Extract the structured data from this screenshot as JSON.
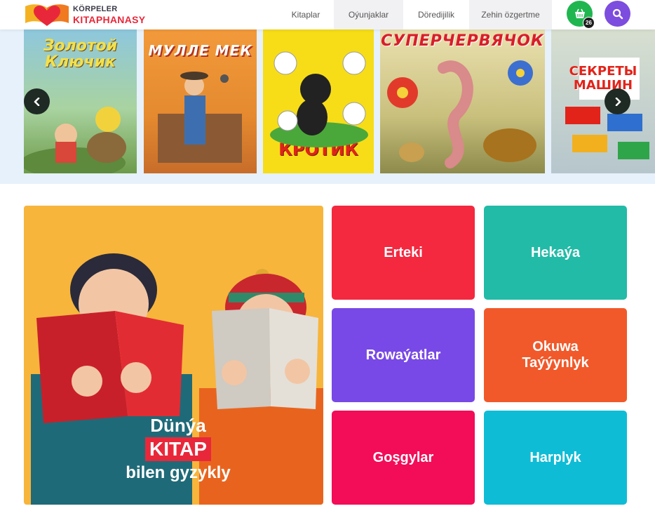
{
  "header": {
    "logo": {
      "line1": "KÖRPELER",
      "line2": "KITAPHANASY",
      "icon": "open-book-heart-icon"
    },
    "nav": [
      {
        "label": "Kitaplar"
      },
      {
        "label": "Oýunjaklar"
      },
      {
        "label": "Döredijilik"
      },
      {
        "label": "Zehin özgertme"
      }
    ],
    "cart": {
      "icon": "basket-icon",
      "count": "26",
      "color": "#1fb650"
    },
    "search": {
      "icon": "search-icon",
      "color": "#7c4ddf"
    }
  },
  "carousel": {
    "books": [
      {
        "title": "Золотой Ключик"
      },
      {
        "title": "МУЛЛЕ МЕК"
      },
      {
        "title": "КРОТИК"
      },
      {
        "title": "СУПЕРЧЕРВЯЧОК"
      },
      {
        "title": "СЕКРЕТЫ МАШИН"
      }
    ],
    "prev_icon": "chevron-left-icon",
    "next_icon": "chevron-right-icon"
  },
  "hero": {
    "line1": "Dünýa",
    "line2": "KITAP",
    "line3": "bilen gyzykly"
  },
  "categories": [
    {
      "label": "Erteki",
      "color": "#f4283f"
    },
    {
      "label": "Hekaýa",
      "color": "#22bba7"
    },
    {
      "label": "Rowaýatlar",
      "color": "#7849e6"
    },
    {
      "label": "Okuwa Taýýynlyk",
      "color": "#f1592a"
    },
    {
      "label": "Goşgylar",
      "color": "#f30c58"
    },
    {
      "label": "Harplyk",
      "color": "#0fbcd6"
    }
  ]
}
